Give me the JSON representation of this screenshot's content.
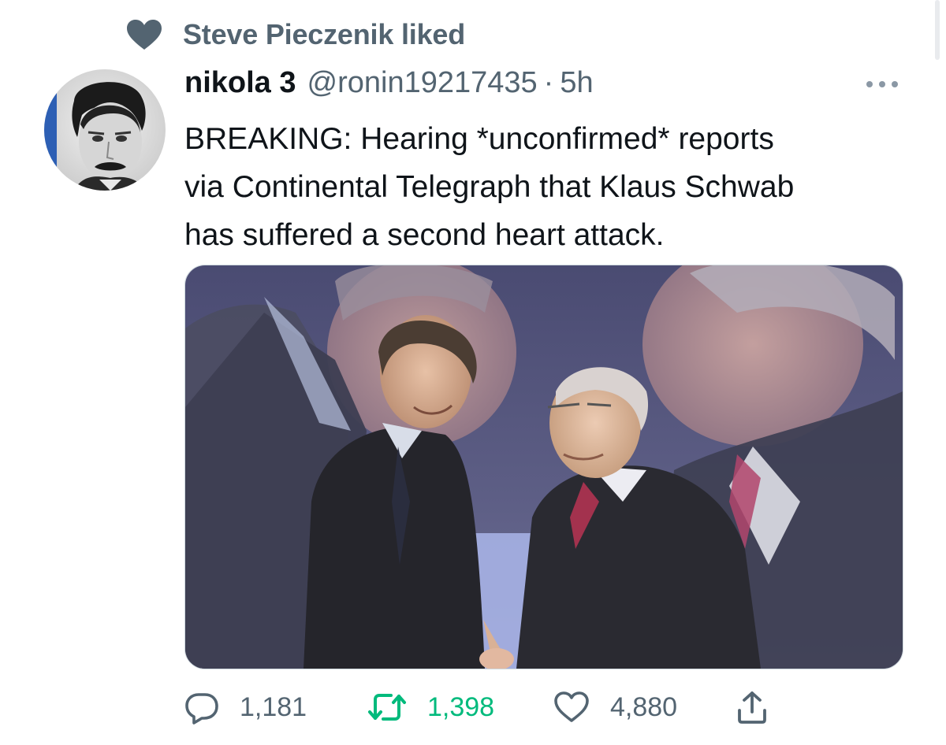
{
  "social_context": {
    "icon": "heart-icon",
    "text": "Steve Pieczenik liked"
  },
  "tweet": {
    "author": {
      "display_name": "nikola 3",
      "handle": "@ronin19217435",
      "separator": "·",
      "time": "5h"
    },
    "text_lines": [
      "BREAKING: Hearing *unconfirmed* reports",
      "via Continental Telegraph that Klaus Schwab",
      "has suffered a second heart attack."
    ],
    "media": {
      "kind": "photo"
    },
    "actions": {
      "reply": {
        "icon": "reply-icon",
        "count": "1,181"
      },
      "retweet": {
        "icon": "retweet-icon",
        "count": "1,398",
        "active": true
      },
      "like": {
        "icon": "like-icon",
        "count": "4,880"
      },
      "share": {
        "icon": "share-icon"
      }
    }
  },
  "colors": {
    "secondary_text": "#536471",
    "retweet_active": "#00ba7c",
    "primary_text": "#0f1419"
  }
}
